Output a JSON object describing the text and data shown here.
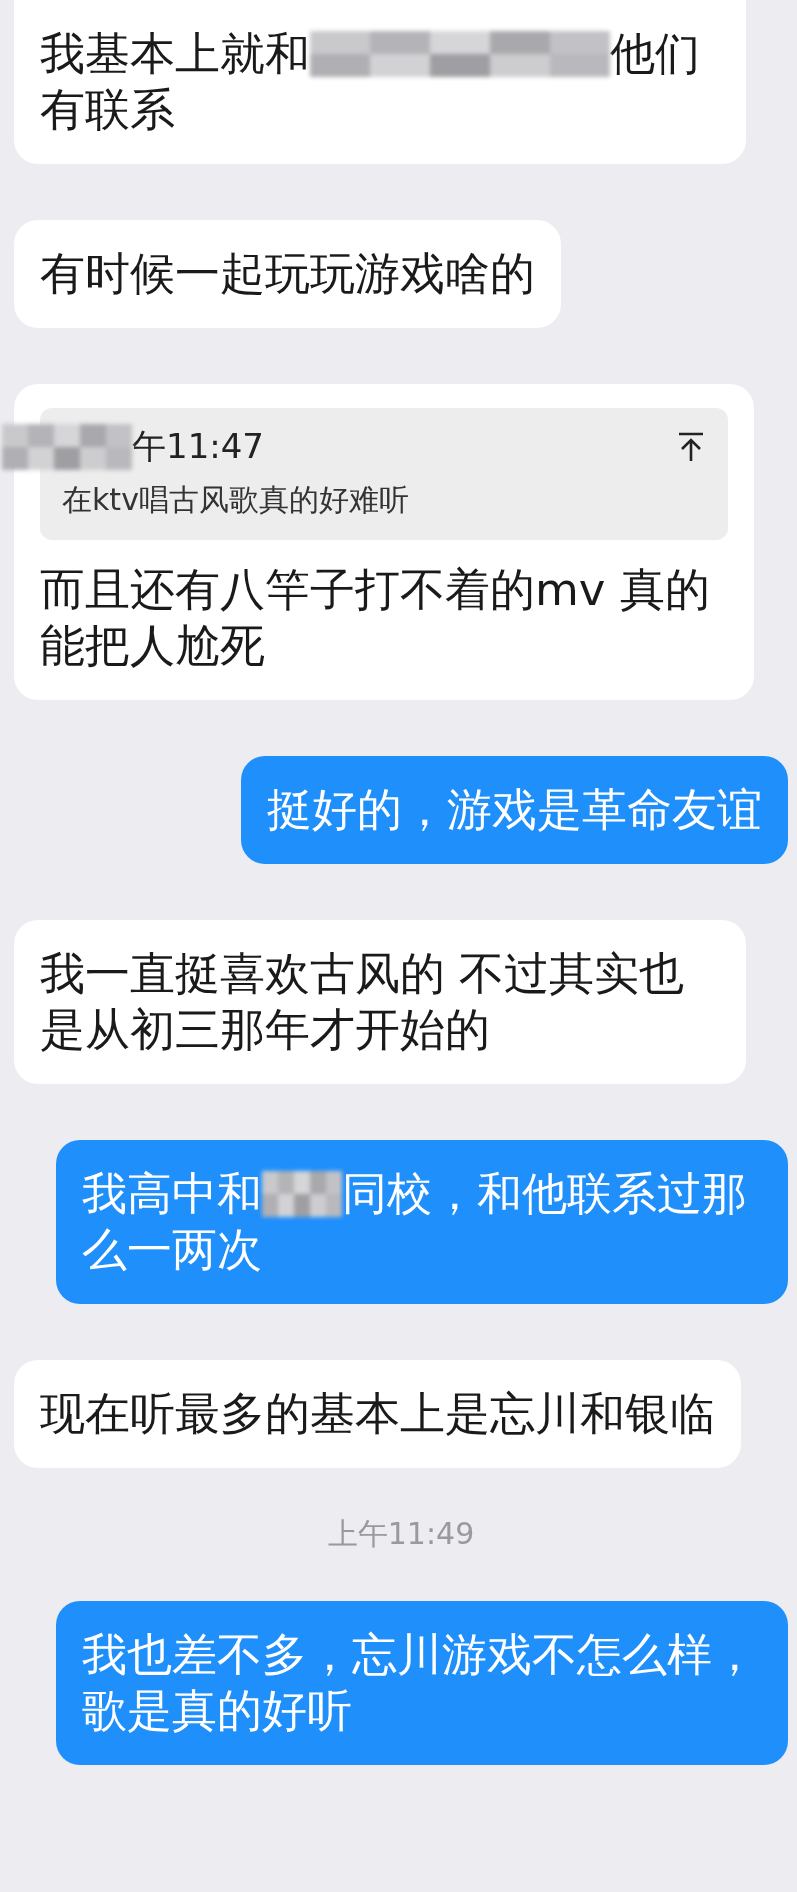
{
  "messages": [
    {
      "kind": "incoming",
      "parts": [
        {
          "kind": "text",
          "text": "我基本上就和"
        },
        {
          "kind": "redaction"
        },
        {
          "kind": "text",
          "text": "他们有联系"
        }
      ]
    },
    {
      "kind": "incoming",
      "parts": [
        {
          "kind": "text",
          "text": "有时候一起玩玩游戏啥的"
        }
      ]
    },
    {
      "kind": "incoming",
      "quote": {
        "parts": [
          {
            "kind": "redaction"
          },
          {
            "kind": "text",
            "text": "午11:47"
          }
        ],
        "text": "在ktv唱古风歌真的好难听"
      },
      "parts": [
        {
          "kind": "text",
          "text": "而且还有八竿子打不着的mv 真的能把人尬死"
        }
      ]
    },
    {
      "kind": "outgoing",
      "parts": [
        {
          "kind": "text",
          "text": "挺好的，游戏是革命友谊"
        }
      ]
    },
    {
      "kind": "incoming",
      "parts": [
        {
          "kind": "text",
          "text": "我一直挺喜欢古风的 不过其实也是从初三那年才开始的"
        }
      ]
    },
    {
      "kind": "outgoing",
      "parts": [
        {
          "kind": "text",
          "text": "我高中和"
        },
        {
          "kind": "redaction"
        },
        {
          "kind": "text",
          "text": "同校，和他联系过那么一两次"
        }
      ]
    },
    {
      "kind": "incoming",
      "parts": [
        {
          "kind": "text",
          "text": "现在听最多的基本上是忘川和银临"
        }
      ]
    },
    {
      "kind": "timestamp",
      "text": "上午11:49"
    },
    {
      "kind": "outgoing",
      "parts": [
        {
          "kind": "text",
          "text": "我也差不多，忘川游戏不怎么样，歌是真的好听"
        }
      ]
    }
  ]
}
